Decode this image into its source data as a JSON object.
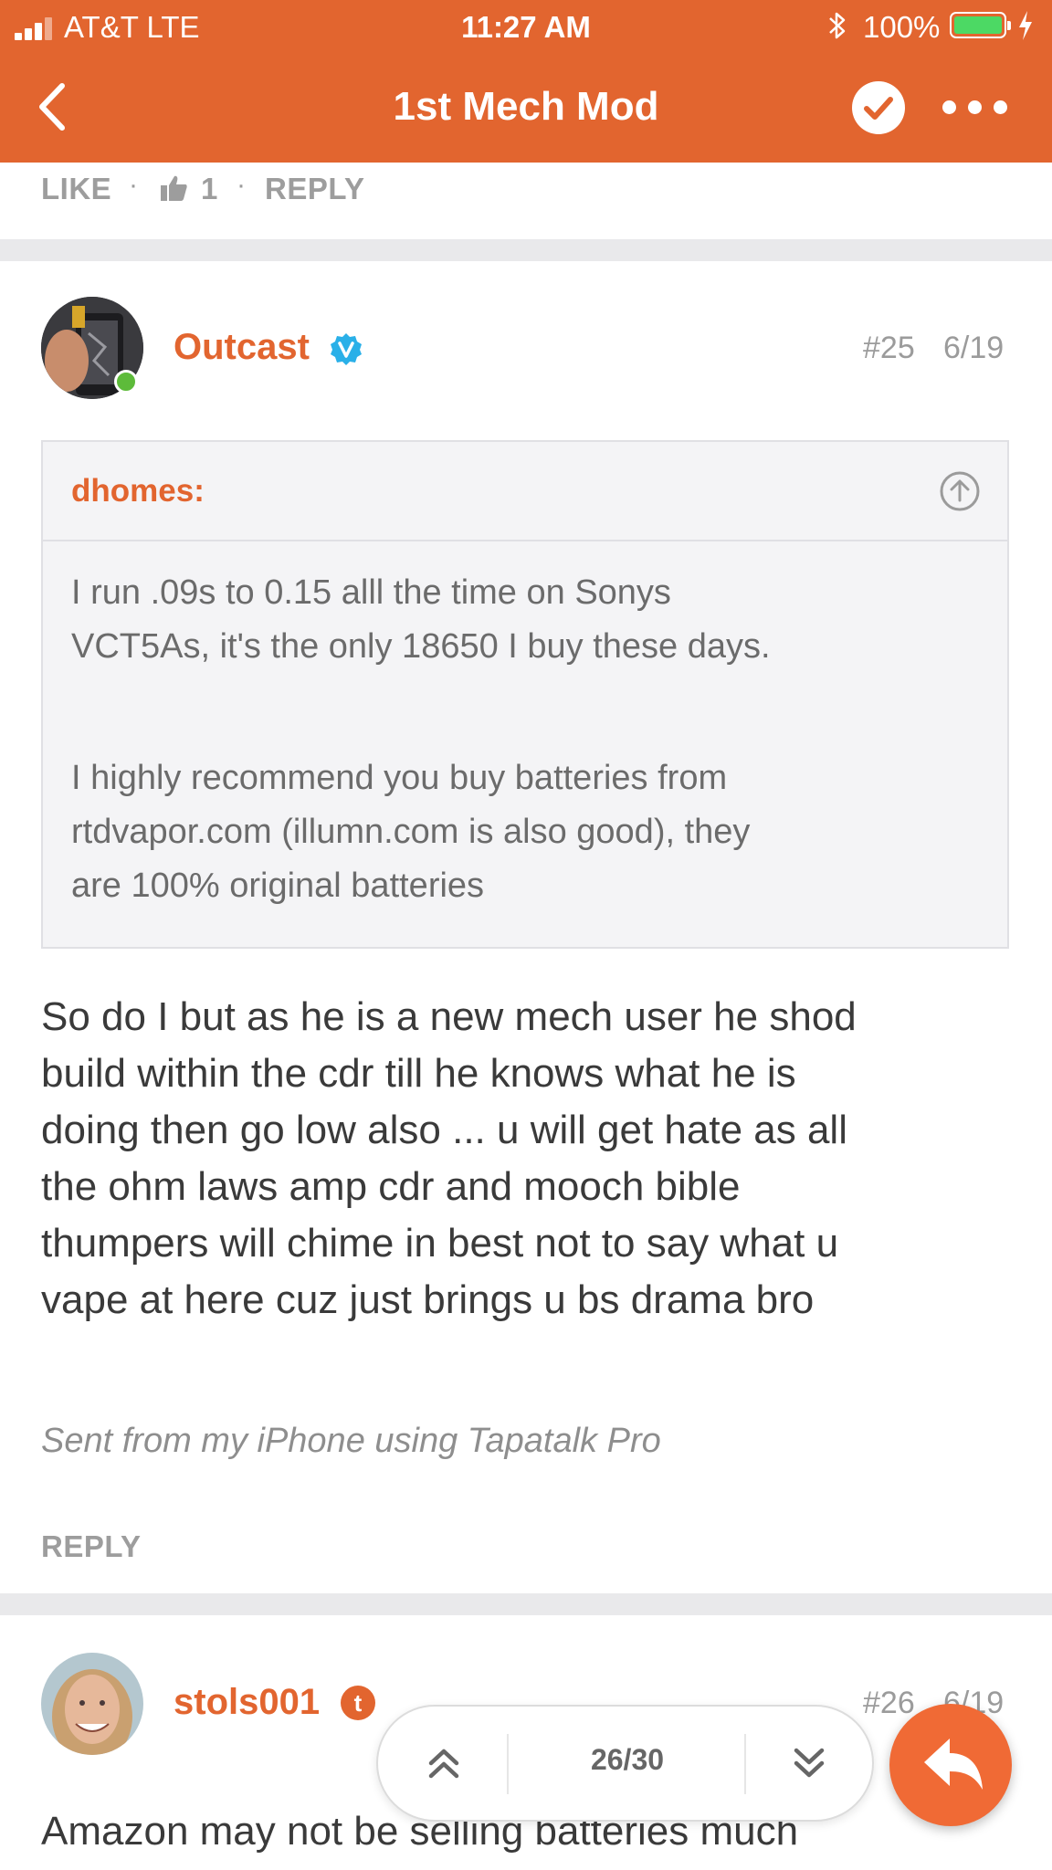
{
  "status_bar": {
    "carrier": "AT&T  LTE",
    "time": "11:27 AM",
    "battery_percent": "100%",
    "signal_bars": 4,
    "icons": [
      "signal-icon",
      "bluetooth-icon",
      "battery-icon",
      "charging-icon"
    ]
  },
  "nav": {
    "title": "1st Mech Mod",
    "icons": [
      "back-arrow-icon",
      "check-circle-icon",
      "more-icon"
    ]
  },
  "prev_post_actions": {
    "like": "LIKE",
    "dot": "·",
    "like_count": "1",
    "reply": "REPLY"
  },
  "post25": {
    "username": "Outcast",
    "badge": "V",
    "number": "#25",
    "date": "6/19",
    "quote": {
      "author": "dhomes:",
      "line1": "I run .09s to 0.15 alll the time on Sonys",
      "line2": "VCT5As, it's the only 18650 I buy these days.",
      "line3": "I highly recommend you buy batteries from",
      "line4": "rtdvapor.com (illumn.com is also good), they",
      "line5": "are 100% original batteries"
    },
    "body": {
      "line1": "So do I but as he is a new mech user he shod",
      "line2": "build within the cdr till he knows what he is",
      "line3": "doing then go low also ... u will get hate as all",
      "line4": "the ohm laws amp cdr and mooch bible",
      "line5": "thumpers will chime in best not to say what u",
      "line6": "vape at here cuz just brings u bs drama bro"
    },
    "signature": "Sent from my iPhone using Tapatalk Pro",
    "reply": "REPLY"
  },
  "post26": {
    "username": "stols001",
    "badge": "t",
    "number": "#26",
    "date": "6/19",
    "body_partial": "Amazon may not be selling batteries much"
  },
  "pager": {
    "label": "26/30"
  },
  "colors": {
    "accent": "#e2652f",
    "fab": "#f06a35",
    "verified": "#2ab0e8",
    "online": "#5dbb3a"
  }
}
